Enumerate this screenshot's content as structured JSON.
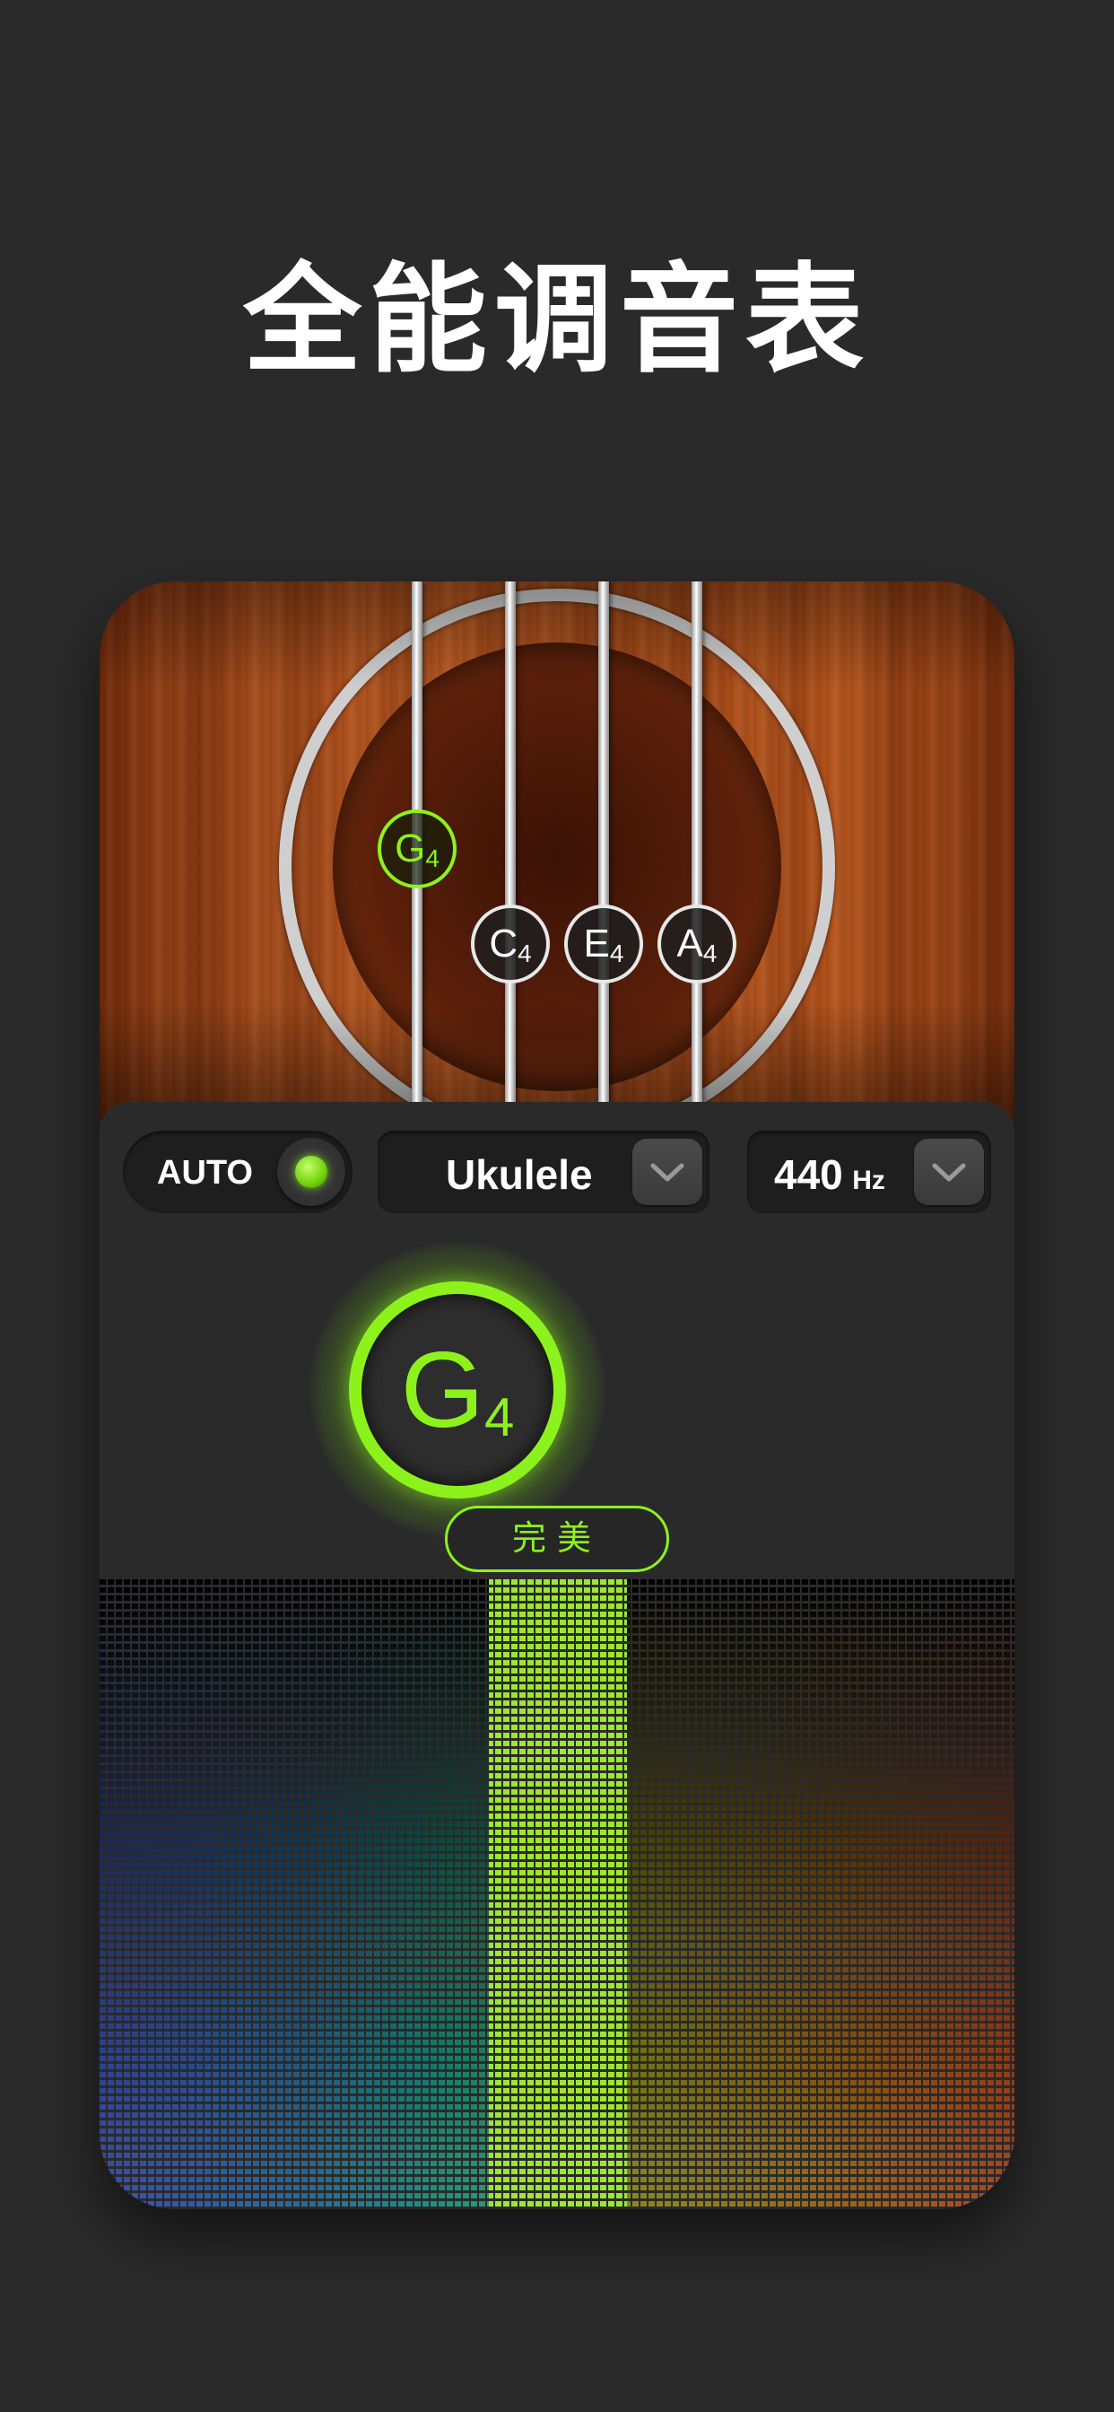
{
  "headline": "全能调音表",
  "strings": [
    {
      "note": "G",
      "octave": "4",
      "active": true
    },
    {
      "note": "C",
      "octave": "4",
      "active": false
    },
    {
      "note": "E",
      "octave": "4",
      "active": false
    },
    {
      "note": "A",
      "octave": "4",
      "active": false
    }
  ],
  "controls": {
    "auto_label": "AUTO",
    "auto_on": true,
    "instrument": "Ukulele",
    "reference_value": "440",
    "reference_unit": "Hz"
  },
  "meter": {
    "note": "G",
    "octave": "4",
    "status": "完美"
  },
  "colors": {
    "accent": "#8df21c",
    "background": "#2a2a2a",
    "wood": "#b5531c"
  }
}
